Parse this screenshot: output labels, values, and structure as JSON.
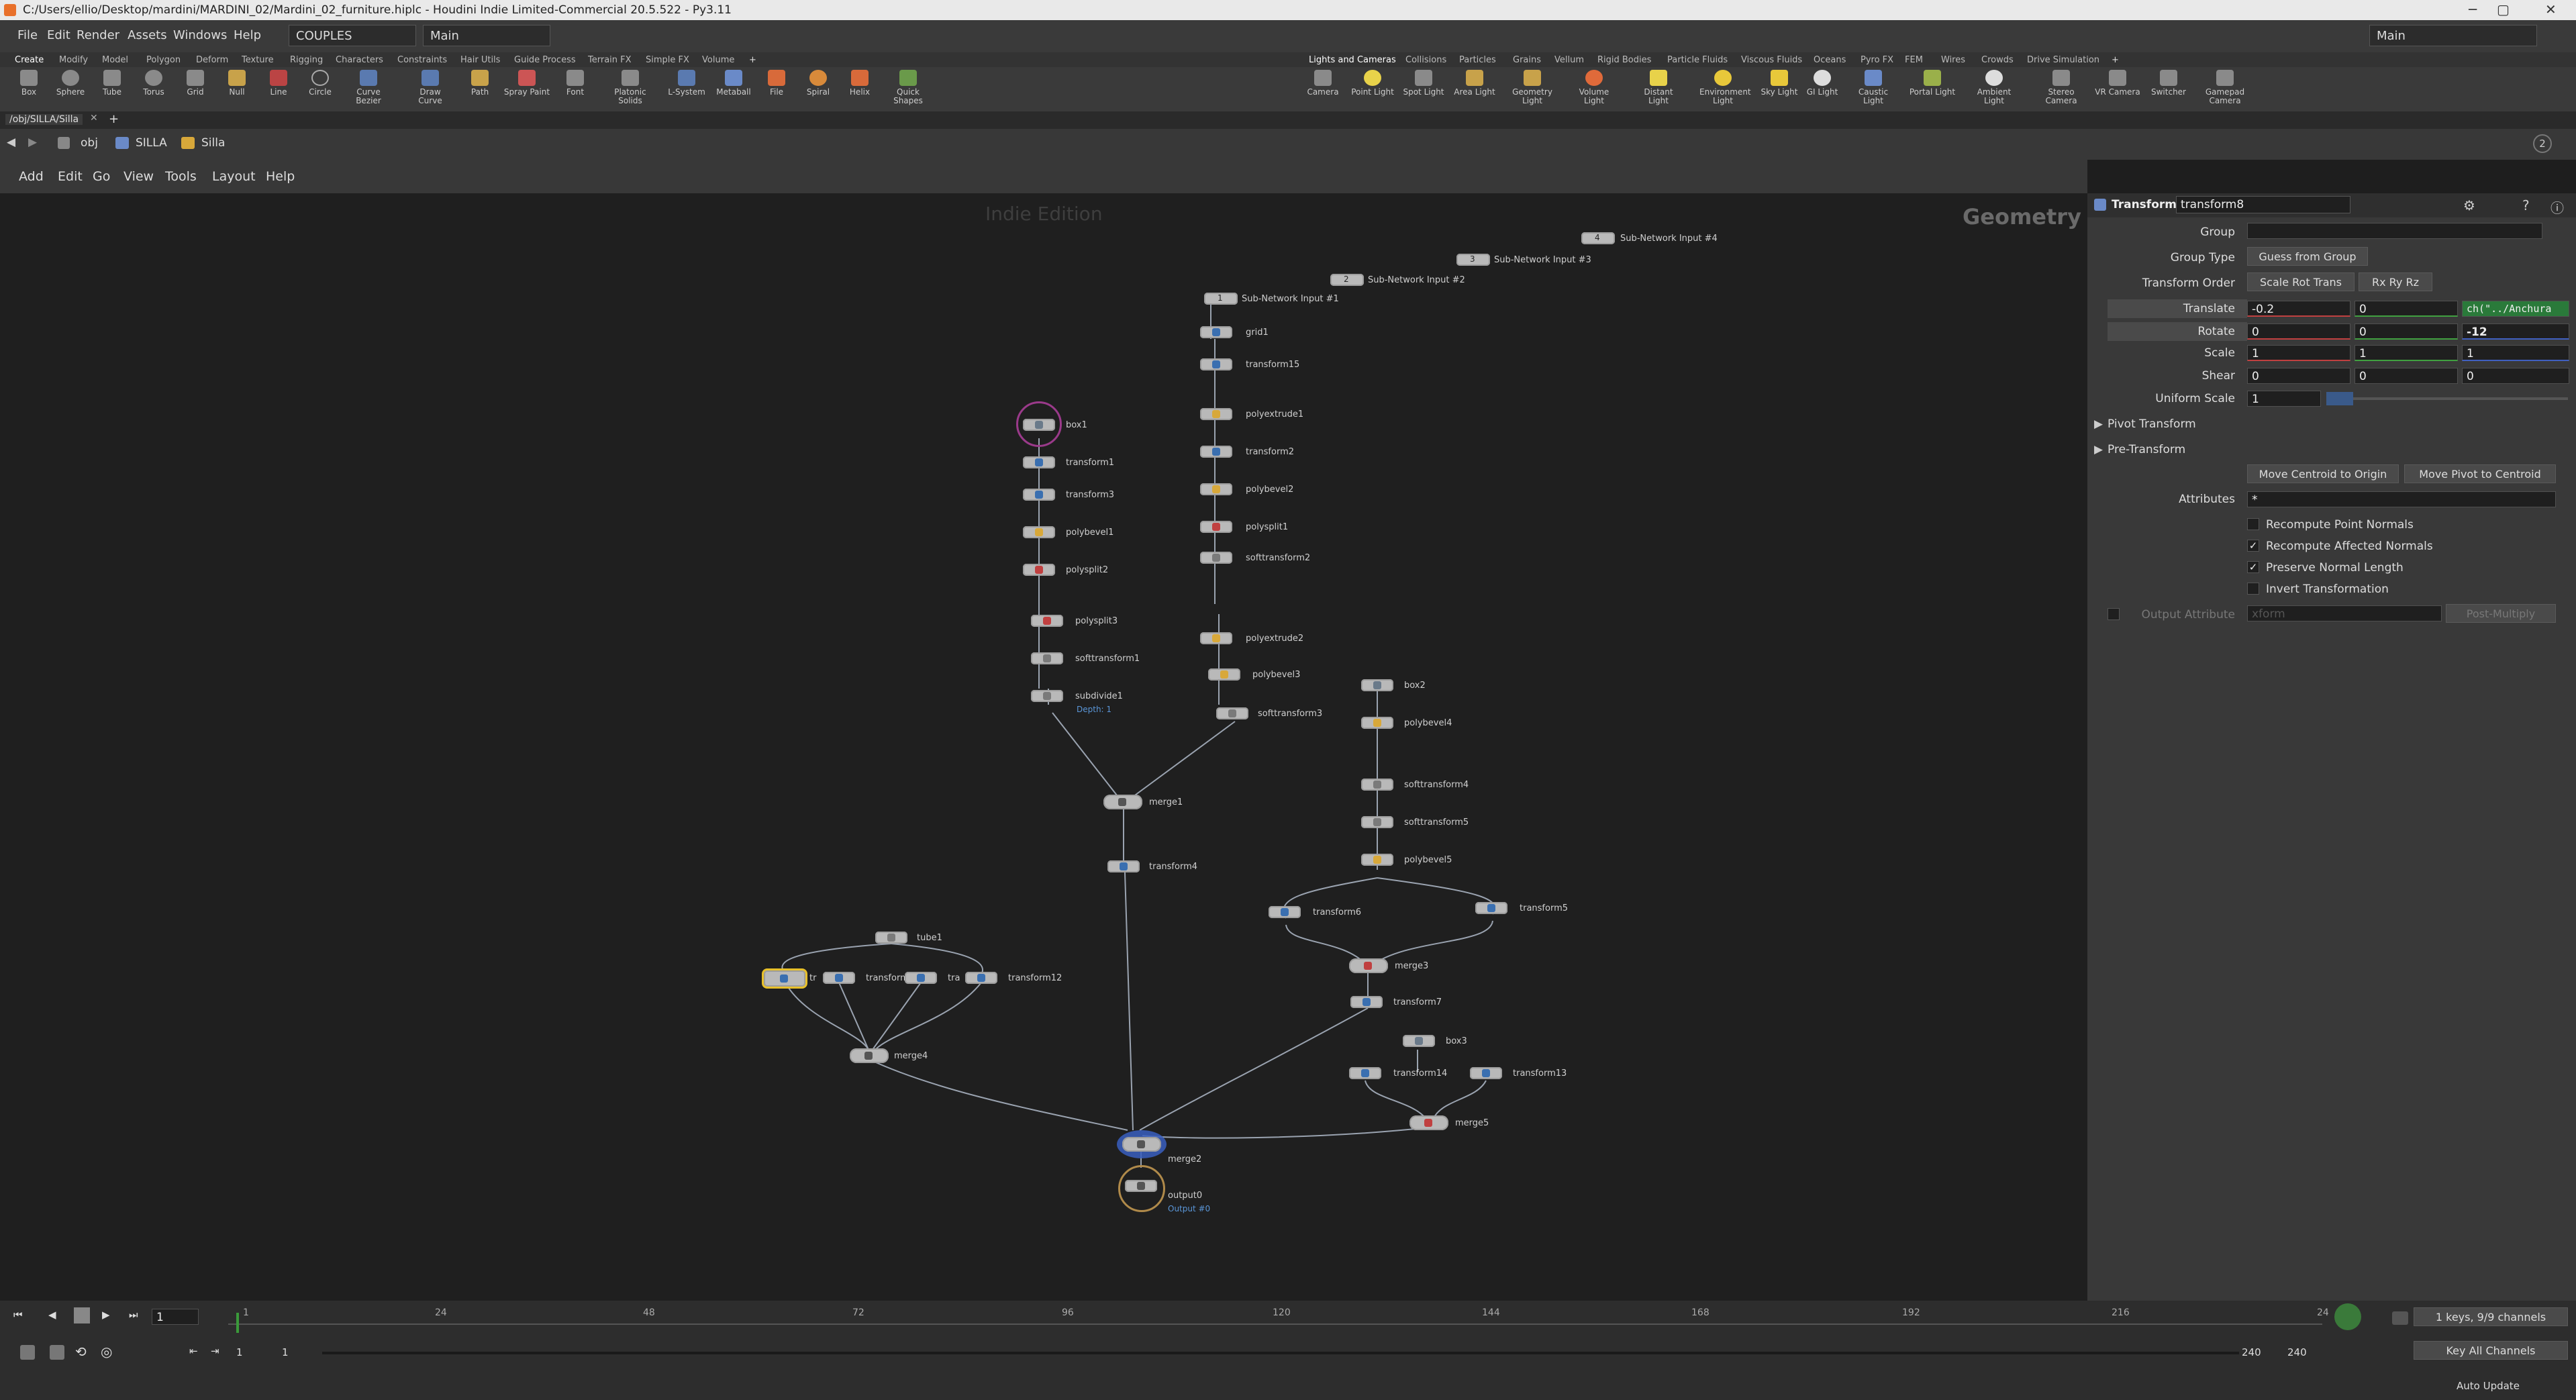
{
  "titlebar": {
    "title": "C:/Users/ellio/Desktop/mardini/MARDINI_02/Mardini_02_furniture.hiplc - Houdini Indie Limited-Commercial 20.5.522 - Py3.11",
    "min": "─",
    "max": "▢",
    "close": "✕"
  },
  "menubar": {
    "items": [
      "File",
      "Edit",
      "Render",
      "Assets",
      "Windows",
      "Help"
    ],
    "desktop": "COUPLES",
    "main": "Main",
    "right_main": "Main"
  },
  "shelf_tabs_left": [
    "Create",
    "Modify",
    "Model",
    "Polygon",
    "Deform",
    "Texture",
    "Rigging",
    "Characters",
    "Constraints",
    "Hair Utils",
    "Guide Process",
    "Terrain FX",
    "Simple FX",
    "Volume"
  ],
  "shelf_tabs_right": [
    "Lights and Cameras",
    "Collisions",
    "Particles",
    "Grains",
    "Vellum",
    "Rigid Bodies",
    "Particle Fluids",
    "Viscous Fluids",
    "Oceans",
    "Pyro FX",
    "FEM",
    "Wires",
    "Crowds",
    "Drive Simulation"
  ],
  "tools_left": [
    "Box",
    "Sphere",
    "Tube",
    "Torus",
    "Grid",
    "Null",
    "Line",
    "Circle",
    "Curve Bezier",
    "Draw Curve",
    "Path",
    "Spray Paint",
    "Font",
    "Platonic Solids",
    "L-System",
    "Metaball",
    "File",
    "Spiral",
    "Helix",
    "Quick Shapes"
  ],
  "tools_right": [
    "Camera",
    "Point Light",
    "Spot Light",
    "Area Light",
    "Geometry Light",
    "Volume Light",
    "Distant Light",
    "Environment Light",
    "Sky Light",
    "GI Light",
    "Caustic Light",
    "Portal Light",
    "Ambient Light",
    "Stereo Camera",
    "VR Camera",
    "Switcher",
    "Gamepad Camera"
  ],
  "path_tab": "/obj/SILLA/Silla",
  "nav": {
    "obj": "obj",
    "silla_upper": "SILLA",
    "silla": "Silla"
  },
  "network_menu": [
    "Add",
    "Edit",
    "Go",
    "View",
    "Tools",
    "Layout",
    "Help"
  ],
  "network": {
    "watermark": "Indie Edition",
    "context": "Geometry"
  },
  "nodes": [
    {
      "name": "Sub-Network Input #4",
      "badge": "4"
    },
    {
      "name": "Sub-Network Input #3",
      "badge": "3"
    },
    {
      "name": "Sub-Network Input #2",
      "badge": "2"
    },
    {
      "name": "Sub-Network Input #1",
      "badge": "1"
    },
    {
      "name": "grid1"
    },
    {
      "name": "transform15"
    },
    {
      "name": "polyextrude1"
    },
    {
      "name": "transform2"
    },
    {
      "name": "polybevel2"
    },
    {
      "name": "polysplit1"
    },
    {
      "name": "softtransform2"
    },
    {
      "name": "polyextrude2"
    },
    {
      "name": "polybevel3"
    },
    {
      "name": "softtransform3"
    },
    {
      "name": "box1"
    },
    {
      "name": "transform1"
    },
    {
      "name": "transform3"
    },
    {
      "name": "polybevel1"
    },
    {
      "name": "polysplit2"
    },
    {
      "name": "polysplit3"
    },
    {
      "name": "softtransform1"
    },
    {
      "name": "subdivide1",
      "sub": "Depth: 1"
    },
    {
      "name": "merge1"
    },
    {
      "name": "transform4"
    },
    {
      "name": "box2"
    },
    {
      "name": "polybevel4"
    },
    {
      "name": "softtransform4"
    },
    {
      "name": "softtransform5"
    },
    {
      "name": "polybevel5"
    },
    {
      "name": "transform6"
    },
    {
      "name": "transform5"
    },
    {
      "name": "merge3"
    },
    {
      "name": "transform7"
    },
    {
      "name": "tube1"
    },
    {
      "name": "tr"
    },
    {
      "name": "transform"
    },
    {
      "name": "tra"
    },
    {
      "name": "transform12"
    },
    {
      "name": "merge4"
    },
    {
      "name": "box3"
    },
    {
      "name": "transform14"
    },
    {
      "name": "transform13"
    },
    {
      "name": "merge5"
    },
    {
      "name": "merge2"
    },
    {
      "name": "output0",
      "sub": "Output #0"
    }
  ],
  "parm": {
    "type": "Transform",
    "node_name": "transform8",
    "group_label": "Group",
    "group_type_label": "Group Type",
    "group_type": "Guess from Group",
    "order_label": "Transform Order",
    "order": "Scale Rot Trans",
    "rot_order": "Rx Ry Rz",
    "translate_label": "Translate",
    "translate": [
      "-0.2",
      "0",
      "ch(\"../Anchura"
    ],
    "rotate_label": "Rotate",
    "rotate": [
      "0",
      "0",
      "-12"
    ],
    "scale_label": "Scale",
    "scale": [
      "1",
      "1",
      "1"
    ],
    "shear_label": "Shear",
    "shear": [
      "0",
      "0",
      "0"
    ],
    "uniform_label": "Uniform Scale",
    "uniform": "1",
    "pivot": "Pivot Transform",
    "pre": "Pre-Transform",
    "btn_centroid": "Move Centroid to Origin",
    "btn_pivot": "Move Pivot to Centroid",
    "attributes_label": "Attributes",
    "attributes": "*",
    "checks": [
      {
        "label": "Recompute Point Normals",
        "checked": ""
      },
      {
        "label": "Recompute Affected Normals",
        "checked": "✓"
      },
      {
        "label": "Preserve Normal Length",
        "checked": "✓"
      },
      {
        "label": "Invert Transformation",
        "checked": ""
      }
    ],
    "output_attr_label": "Output Attribute",
    "output_attr": "xform",
    "post": "Post-Multiply"
  },
  "timeline": {
    "ticks": [
      "1",
      "24",
      "48",
      "72",
      "96",
      "120",
      "144",
      "168",
      "192",
      "216",
      "24"
    ],
    "frame": "1",
    "start": "1",
    "start2": "1",
    "end1": "240",
    "end2": "240",
    "keys": "1 keys, 9/9 channels",
    "keyall": "Key All Channels",
    "auto": "Auto Update"
  }
}
